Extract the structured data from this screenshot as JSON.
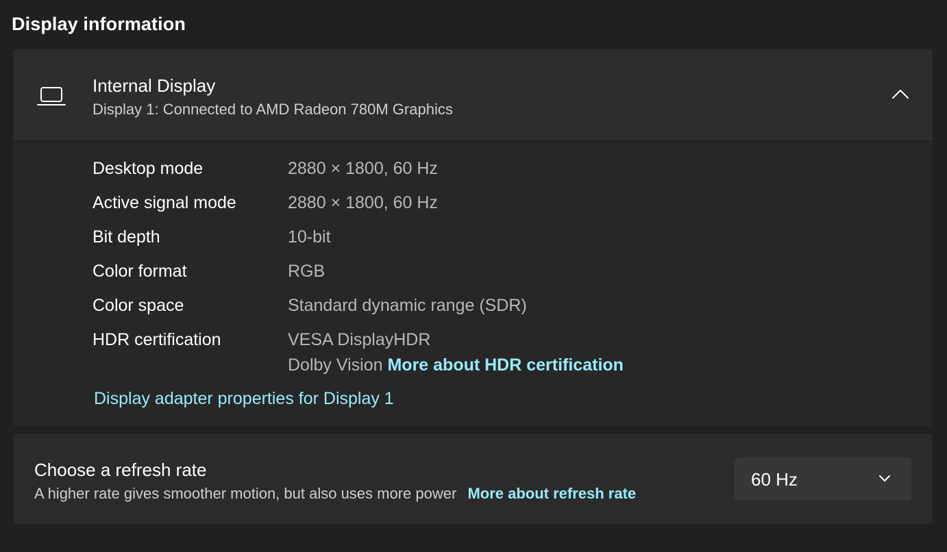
{
  "page": {
    "title": "Display information"
  },
  "display": {
    "name": "Internal Display",
    "subtitle": "Display 1: Connected to AMD Radeon 780M Graphics",
    "icon": "laptop-icon",
    "collapse_icon": "chevron-up-icon",
    "details": [
      {
        "label": "Desktop mode",
        "value": "2880 × 1800, 60 Hz"
      },
      {
        "label": "Active signal mode",
        "value": "2880 × 1800, 60 Hz"
      },
      {
        "label": "Bit depth",
        "value": "10-bit"
      },
      {
        "label": "Color format",
        "value": "RGB"
      },
      {
        "label": "Color space",
        "value": "Standard dynamic range (SDR)"
      },
      {
        "label": "HDR certification",
        "value": "VESA DisplayHDR",
        "value2": "Dolby Vision",
        "link": "More about HDR certification"
      }
    ],
    "adapter_link": "Display adapter properties for Display 1"
  },
  "refresh": {
    "title": "Choose a refresh rate",
    "description": "A higher rate gives smoother motion, but also uses more power",
    "link": "More about refresh rate",
    "selected": "60 Hz",
    "dropdown_icon": "chevron-down-icon"
  },
  "colors": {
    "background": "#202020",
    "card": "#2b2b2b",
    "accent_link": "#99ebff",
    "secondary_text": "#b8b8b8"
  }
}
